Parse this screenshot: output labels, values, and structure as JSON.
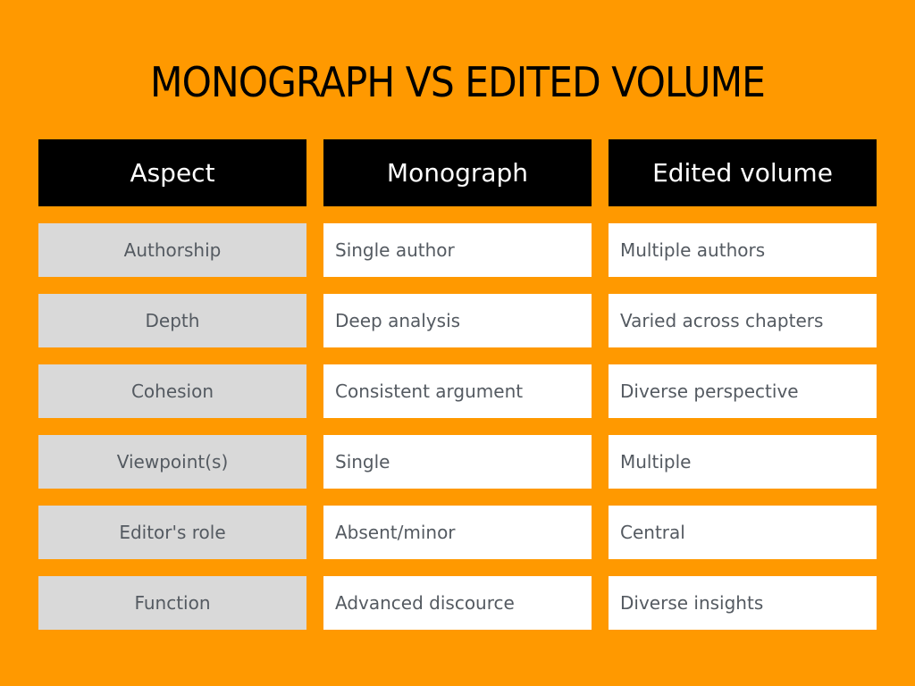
{
  "title": "MONOGRAPH VS EDITED VOLUME",
  "colors": {
    "background": "#ff9900",
    "header_bg": "#000000",
    "header_text": "#ffffff",
    "aspect_bg": "#d9d9d9",
    "value_bg": "#ffffff",
    "body_text": "#545a61"
  },
  "table": {
    "headers": [
      "Aspect",
      "Monograph",
      "Edited volume"
    ],
    "rows": [
      {
        "aspect": "Authorship",
        "monograph": "Single author",
        "edited_volume": "Multiple authors"
      },
      {
        "aspect": "Depth",
        "monograph": "Deep analysis",
        "edited_volume": "Varied across chapters"
      },
      {
        "aspect": "Cohesion",
        "monograph": "Consistent argument",
        "edited_volume": "Diverse perspective"
      },
      {
        "aspect": "Viewpoint(s)",
        "monograph": "Single",
        "edited_volume": "Multiple"
      },
      {
        "aspect": "Editor's role",
        "monograph": "Absent/minor",
        "edited_volume": "Central"
      },
      {
        "aspect": "Function",
        "monograph": "Advanced discource",
        "edited_volume": "Diverse insights"
      }
    ]
  }
}
